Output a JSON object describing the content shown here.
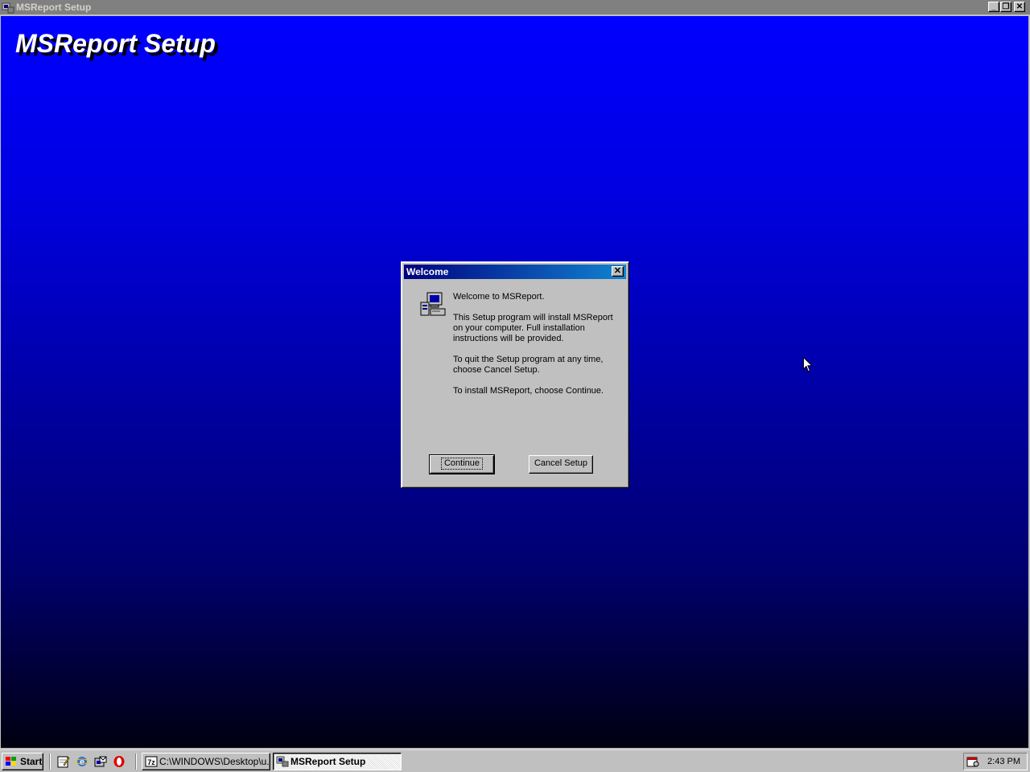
{
  "window": {
    "title": "MSReport Setup",
    "buttons": {
      "minimize": "_",
      "restore": "❐",
      "close": "✕"
    }
  },
  "app_banner": "MSReport Setup",
  "dialog": {
    "title": "Welcome",
    "close_glyph": "✕",
    "welcome_line": "Welcome to MSReport.",
    "paragraph_install": "This Setup program will install MSReport on your computer. Full installation instructions will be provided.",
    "paragraph_quit": "To quit the Setup program at any time, choose Cancel Setup.",
    "paragraph_continue": "To install MSReport, choose Continue.",
    "continue_label": "Continue",
    "cancel_label": "Cancel Setup"
  },
  "taskbar": {
    "start_label": "Start",
    "tasks": [
      {
        "label": "C:\\WINDOWS\\Desktop\\u...",
        "icon": "7zip-icon",
        "active": false
      },
      {
        "label": "MSReport Setup",
        "icon": "setup-icon",
        "active": true
      }
    ],
    "quicklaunch": [
      "edit-icon",
      "ie-icon",
      "outlook-icon",
      "opera-icon"
    ],
    "clock": "2:43 PM"
  },
  "colors": {
    "gradient_top": "#0000ff",
    "gradient_bottom": "#000010",
    "dialog_title_start": "#000080",
    "dialog_title_end": "#1084d0"
  }
}
